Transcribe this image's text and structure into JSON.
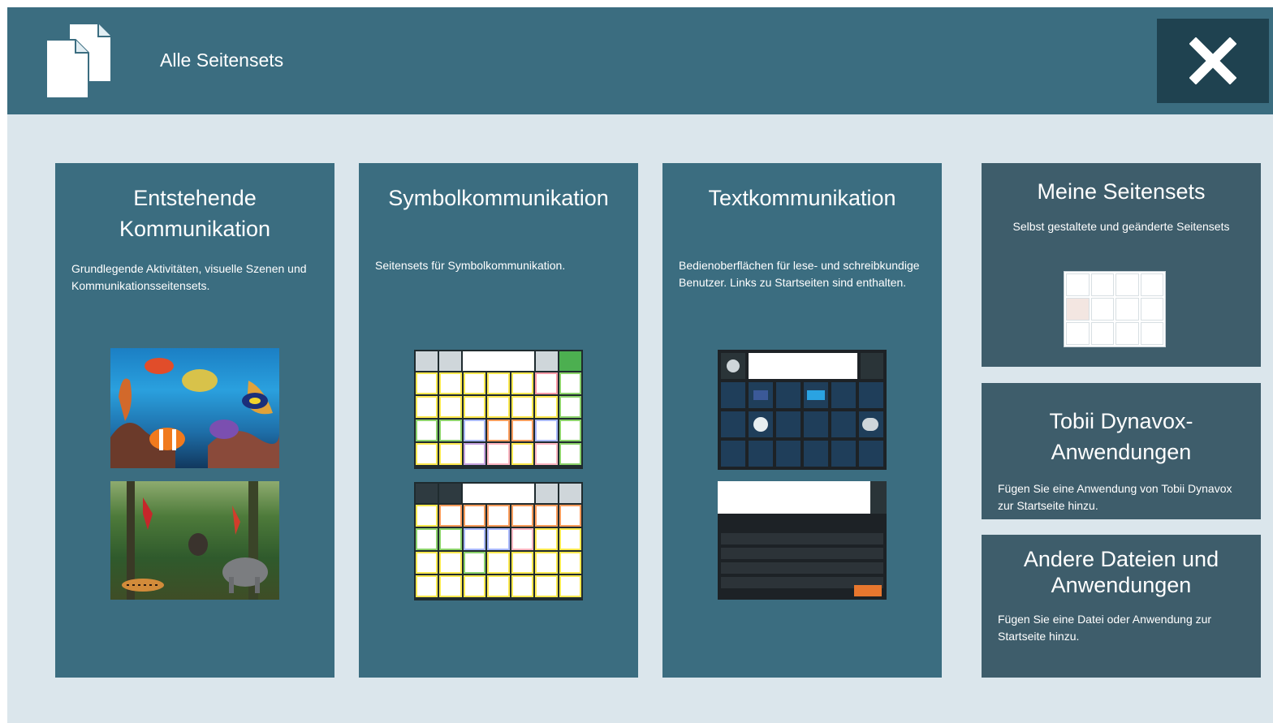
{
  "header": {
    "title": "Alle Seitensets",
    "icon": "documents-icon",
    "close_icon": "close-icon"
  },
  "categories": [
    {
      "title_line1": "Entstehende",
      "title_line2": "Kommunikation",
      "description": "Grundlegende Aktivitäten, visuelle Szenen und Kommunikationsseitensets.",
      "previews": [
        "ocean-scene-thumbnail",
        "jungle-scene-thumbnail"
      ]
    },
    {
      "title": "Symbolkommunikation",
      "description": "Seitensets für Symbolkommunikation.",
      "previews": [
        "symbol-grid-thumbnail",
        "symbol-grid-thumbnail"
      ]
    },
    {
      "title": "Textkommunikation",
      "description": "Bedienoberflächen für lese- und schreibkundige Benutzer. Links zu Startseiten sind enthalten.",
      "previews": [
        "app-launcher-thumbnail",
        "keyboard-thumbnail"
      ]
    }
  ],
  "side_cards": [
    {
      "title": "Meine Seitensets",
      "description": "Selbst gestaltete und geänderte Seitensets"
    },
    {
      "title": "Tobii Dynavox-Anwendungen",
      "description": "Fügen Sie eine Anwendung von Tobii Dynavox zur Startseite hinzu."
    },
    {
      "title_line1": "Andere Dateien und",
      "title_line2": "Anwendungen",
      "description": "Fügen Sie eine Datei oder Anwendung zur Startseite hinzu."
    }
  ],
  "colors": {
    "header": "#3b6d80",
    "background": "#dbe6ec",
    "card": "#3b6d80",
    "side_card": "#3e5d6b",
    "close_button": "#1f4250"
  }
}
